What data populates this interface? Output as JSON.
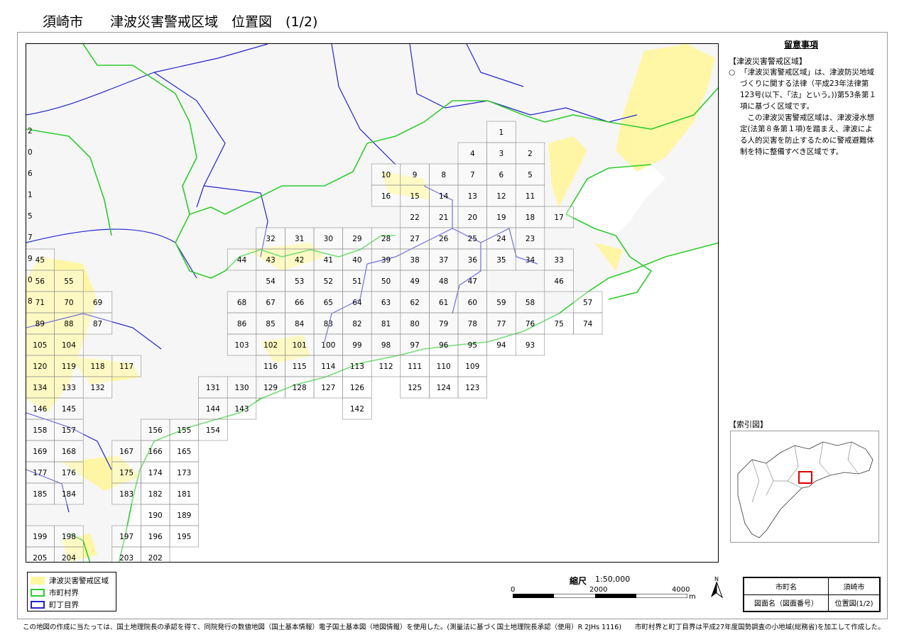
{
  "page": {
    "title_city": "須崎市",
    "title_main": "津波災害警戒区域　位置図　(1/2)"
  },
  "notes": {
    "title": "留意事項",
    "section_head": "【津波災害警戒区域】",
    "mark": "○",
    "para1": "「津波災害警戒区域」は、津波防災地域づくりに関する法律（平成23年法律第123号(以下、「法」という。))第53条第１項に基づく区域です。",
    "para2": "この津波災害警戒区域は、津波浸水想定(法第８条第１項)を踏まえ、津波による人的災害を防止するために警戒避難体制を特に整備すべき区域です。"
  },
  "index_map": {
    "head": "【索引図】",
    "highlight_color": "#e00000"
  },
  "legend": {
    "items": [
      {
        "label": "津波災害警戒区域",
        "color": "#fff7a0",
        "kind": "fill"
      },
      {
        "label": "市町村界",
        "color": "#2ecc2e",
        "kind": "outline"
      },
      {
        "label": "町丁目界",
        "color": "#2222cc",
        "kind": "outline"
      }
    ]
  },
  "scale": {
    "title": "縮尺",
    "ratio": "1:50,000",
    "ticks": [
      "0",
      "2000",
      "4000"
    ],
    "unit": "m"
  },
  "north_label": "N",
  "infobox": {
    "rows": [
      [
        "市町名",
        "須崎市"
      ],
      [
        "図面名（図面番号）",
        "位置図(1/2)"
      ]
    ]
  },
  "footer": "この地図の作成に当たっては、国土地理院長の承認を得て、同院発行の数値地図（国土基本情報）電子国土基本図（地図情報）を使用した。(測量法に基づく国土地理院長承認（使用）R 2JHs 1116)　　市町村界と町丁目界は平成27年度国勢調査の小地域(総務省)を加工して作成した。",
  "colors": {
    "tsunami_zone": "#fff7a0",
    "municipal_border": "#2ecc2e",
    "town_border": "#2222cc",
    "grid_line": "#8a8a8a"
  },
  "grid_cells": [
    {
      "id": "1",
      "col": 16,
      "row": 2
    },
    {
      "id": "2",
      "col": 17,
      "row": 3
    },
    {
      "id": "3",
      "col": 16,
      "row": 3
    },
    {
      "id": "4",
      "col": 15,
      "row": 3
    },
    {
      "id": "5",
      "col": 17,
      "row": 4
    },
    {
      "id": "6",
      "col": 16,
      "row": 4
    },
    {
      "id": "7",
      "col": 15,
      "row": 4
    },
    {
      "id": "8",
      "col": 14,
      "row": 4
    },
    {
      "id": "9",
      "col": 13,
      "row": 4
    },
    {
      "id": "10",
      "col": 12,
      "row": 4
    },
    {
      "id": "11",
      "col": 17,
      "row": 5
    },
    {
      "id": "12",
      "col": 16,
      "row": 5
    },
    {
      "id": "13",
      "col": 15,
      "row": 5
    },
    {
      "id": "14",
      "col": 14,
      "row": 5
    },
    {
      "id": "15",
      "col": 13,
      "row": 5
    },
    {
      "id": "16",
      "col": 12,
      "row": 5
    },
    {
      "id": "17",
      "col": 18,
      "row": 6
    },
    {
      "id": "18",
      "col": 17,
      "row": 6
    },
    {
      "id": "19",
      "col": 16,
      "row": 6
    },
    {
      "id": "20",
      "col": 15,
      "row": 6
    },
    {
      "id": "21",
      "col": 14,
      "row": 6
    },
    {
      "id": "22",
      "col": 13,
      "row": 6
    },
    {
      "id": "23",
      "col": 17,
      "row": 7
    },
    {
      "id": "24",
      "col": 16,
      "row": 7
    },
    {
      "id": "25",
      "col": 15,
      "row": 7
    },
    {
      "id": "26",
      "col": 14,
      "row": 7
    },
    {
      "id": "27",
      "col": 13,
      "row": 7
    },
    {
      "id": "28",
      "col": 12,
      "row": 7
    },
    {
      "id": "29",
      "col": 11,
      "row": 7
    },
    {
      "id": "30",
      "col": 10,
      "row": 7
    },
    {
      "id": "31",
      "col": 9,
      "row": 7
    },
    {
      "id": "32",
      "col": 8,
      "row": 7
    },
    {
      "id": "33",
      "col": 18,
      "row": 8
    },
    {
      "id": "34",
      "col": 17,
      "row": 8
    },
    {
      "id": "35",
      "col": 16,
      "row": 8
    },
    {
      "id": "36",
      "col": 15,
      "row": 8
    },
    {
      "id": "37",
      "col": 14,
      "row": 8
    },
    {
      "id": "38",
      "col": 13,
      "row": 8
    },
    {
      "id": "39",
      "col": 12,
      "row": 8
    },
    {
      "id": "40",
      "col": 11,
      "row": 8
    },
    {
      "id": "41",
      "col": 10,
      "row": 8
    },
    {
      "id": "42",
      "col": 9,
      "row": 8
    },
    {
      "id": "43",
      "col": 8,
      "row": 8
    },
    {
      "id": "44",
      "col": 7,
      "row": 8
    },
    {
      "id": "45",
      "col": 0,
      "row": 8
    },
    {
      "id": "46",
      "col": 18,
      "row": 9
    },
    {
      "id": "47",
      "col": 15,
      "row": 9
    },
    {
      "id": "48",
      "col": 14,
      "row": 9
    },
    {
      "id": "49",
      "col": 13,
      "row": 9
    },
    {
      "id": "50",
      "col": 12,
      "row": 9
    },
    {
      "id": "51",
      "col": 11,
      "row": 9
    },
    {
      "id": "52",
      "col": 10,
      "row": 9
    },
    {
      "id": "53",
      "col": 9,
      "row": 9
    },
    {
      "id": "54",
      "col": 8,
      "row": 9
    },
    {
      "id": "55",
      "col": 1,
      "row": 9
    },
    {
      "id": "56",
      "col": 0,
      "row": 9
    },
    {
      "id": "57",
      "col": 19,
      "row": 10
    },
    {
      "id": "58",
      "col": 17,
      "row": 10
    },
    {
      "id": "59",
      "col": 16,
      "row": 10
    },
    {
      "id": "60",
      "col": 15,
      "row": 10
    },
    {
      "id": "61",
      "col": 14,
      "row": 10
    },
    {
      "id": "62",
      "col": 13,
      "row": 10
    },
    {
      "id": "63",
      "col": 12,
      "row": 10
    },
    {
      "id": "64",
      "col": 11,
      "row": 10
    },
    {
      "id": "65",
      "col": 10,
      "row": 10
    },
    {
      "id": "66",
      "col": 9,
      "row": 10
    },
    {
      "id": "67",
      "col": 8,
      "row": 10
    },
    {
      "id": "68",
      "col": 7,
      "row": 10
    },
    {
      "id": "69",
      "col": 2,
      "row": 10
    },
    {
      "id": "70",
      "col": 1,
      "row": 10
    },
    {
      "id": "71",
      "col": 0,
      "row": 10
    },
    {
      "id": "74",
      "col": 19,
      "row": 11
    },
    {
      "id": "75",
      "col": 18,
      "row": 11
    },
    {
      "id": "76",
      "col": 17,
      "row": 11
    },
    {
      "id": "77",
      "col": 16,
      "row": 11
    },
    {
      "id": "78",
      "col": 15,
      "row": 11
    },
    {
      "id": "79",
      "col": 14,
      "row": 11
    },
    {
      "id": "80",
      "col": 13,
      "row": 11
    },
    {
      "id": "81",
      "col": 12,
      "row": 11
    },
    {
      "id": "82",
      "col": 11,
      "row": 11
    },
    {
      "id": "83",
      "col": 10,
      "row": 11
    },
    {
      "id": "84",
      "col": 9,
      "row": 11
    },
    {
      "id": "85",
      "col": 8,
      "row": 11
    },
    {
      "id": "86",
      "col": 7,
      "row": 11
    },
    {
      "id": "87",
      "col": 2,
      "row": 11
    },
    {
      "id": "88",
      "col": 1,
      "row": 11
    },
    {
      "id": "89",
      "col": 0,
      "row": 11
    },
    {
      "id": "93",
      "col": 17,
      "row": 12
    },
    {
      "id": "94",
      "col": 16,
      "row": 12
    },
    {
      "id": "95",
      "col": 15,
      "row": 12
    },
    {
      "id": "96",
      "col": 14,
      "row": 12
    },
    {
      "id": "97",
      "col": 13,
      "row": 12
    },
    {
      "id": "98",
      "col": 12,
      "row": 12
    },
    {
      "id": "99",
      "col": 11,
      "row": 12
    },
    {
      "id": "100",
      "col": 10,
      "row": 12
    },
    {
      "id": "101",
      "col": 9,
      "row": 12
    },
    {
      "id": "102",
      "col": 8,
      "row": 12
    },
    {
      "id": "103",
      "col": 7,
      "row": 12
    },
    {
      "id": "104",
      "col": 1,
      "row": 12
    },
    {
      "id": "105",
      "col": 0,
      "row": 12
    },
    {
      "id": "109",
      "col": 15,
      "row": 13
    },
    {
      "id": "110",
      "col": 14,
      "row": 13
    },
    {
      "id": "111",
      "col": 13,
      "row": 13
    },
    {
      "id": "112",
      "col": 12,
      "row": 13
    },
    {
      "id": "113",
      "col": 11,
      "row": 13
    },
    {
      "id": "114",
      "col": 10,
      "row": 13
    },
    {
      "id": "115",
      "col": 9,
      "row": 13
    },
    {
      "id": "116",
      "col": 8,
      "row": 13
    },
    {
      "id": "117",
      "col": 3,
      "row": 13
    },
    {
      "id": "118",
      "col": 2,
      "row": 13
    },
    {
      "id": "119",
      "col": 1,
      "row": 13
    },
    {
      "id": "120",
      "col": 0,
      "row": 13
    },
    {
      "id": "123",
      "col": 15,
      "row": 14
    },
    {
      "id": "124",
      "col": 14,
      "row": 14
    },
    {
      "id": "125",
      "col": 13,
      "row": 14
    },
    {
      "id": "126",
      "col": 11,
      "row": 14
    },
    {
      "id": "127",
      "col": 10,
      "row": 14
    },
    {
      "id": "128",
      "col": 9,
      "row": 14
    },
    {
      "id": "129",
      "col": 8,
      "row": 14
    },
    {
      "id": "130",
      "col": 7,
      "row": 14
    },
    {
      "id": "131",
      "col": 6,
      "row": 14
    },
    {
      "id": "132",
      "col": 2,
      "row": 14
    },
    {
      "id": "133",
      "col": 1,
      "row": 14
    },
    {
      "id": "134",
      "col": 0,
      "row": 14
    },
    {
      "id": "142",
      "col": 11,
      "row": 15
    },
    {
      "id": "143",
      "col": 7,
      "row": 15
    },
    {
      "id": "144",
      "col": 6,
      "row": 15
    },
    {
      "id": "145",
      "col": 1,
      "row": 15
    },
    {
      "id": "146",
      "col": 0,
      "row": 15
    },
    {
      "id": "154",
      "col": 6,
      "row": 16
    },
    {
      "id": "155",
      "col": 5,
      "row": 16
    },
    {
      "id": "156",
      "col": 4,
      "row": 16
    },
    {
      "id": "157",
      "col": 1,
      "row": 16
    },
    {
      "id": "158",
      "col": 0,
      "row": 16
    },
    {
      "id": "165",
      "col": 5,
      "row": 17
    },
    {
      "id": "166",
      "col": 4,
      "row": 17
    },
    {
      "id": "167",
      "col": 3,
      "row": 17
    },
    {
      "id": "168",
      "col": 1,
      "row": 17
    },
    {
      "id": "169",
      "col": 0,
      "row": 17
    },
    {
      "id": "173",
      "col": 5,
      "row": 18
    },
    {
      "id": "174",
      "col": 4,
      "row": 18
    },
    {
      "id": "175",
      "col": 3,
      "row": 18
    },
    {
      "id": "176",
      "col": 1,
      "row": 18
    },
    {
      "id": "177",
      "col": 0,
      "row": 18
    },
    {
      "id": "181",
      "col": 5,
      "row": 19
    },
    {
      "id": "182",
      "col": 4,
      "row": 19
    },
    {
      "id": "183",
      "col": 3,
      "row": 19
    },
    {
      "id": "184",
      "col": 1,
      "row": 19
    },
    {
      "id": "185",
      "col": 0,
      "row": 19
    },
    {
      "id": "189",
      "col": 5,
      "row": 20
    },
    {
      "id": "190",
      "col": 4,
      "row": 20
    },
    {
      "id": "195",
      "col": 5,
      "row": 21
    },
    {
      "id": "196",
      "col": 4,
      "row": 21
    },
    {
      "id": "197",
      "col": 3,
      "row": 21
    },
    {
      "id": "198",
      "col": 1,
      "row": 21
    },
    {
      "id": "199",
      "col": 0,
      "row": 21
    },
    {
      "id": "202",
      "col": 4,
      "row": 22
    },
    {
      "id": "203",
      "col": 3,
      "row": 22
    },
    {
      "id": "204",
      "col": 1,
      "row": 22
    },
    {
      "id": "205",
      "col": 0,
      "row": 22
    }
  ],
  "edge_labels": [
    "2",
    "0",
    "6",
    "1",
    "5",
    "7",
    "9",
    "0",
    "8"
  ]
}
